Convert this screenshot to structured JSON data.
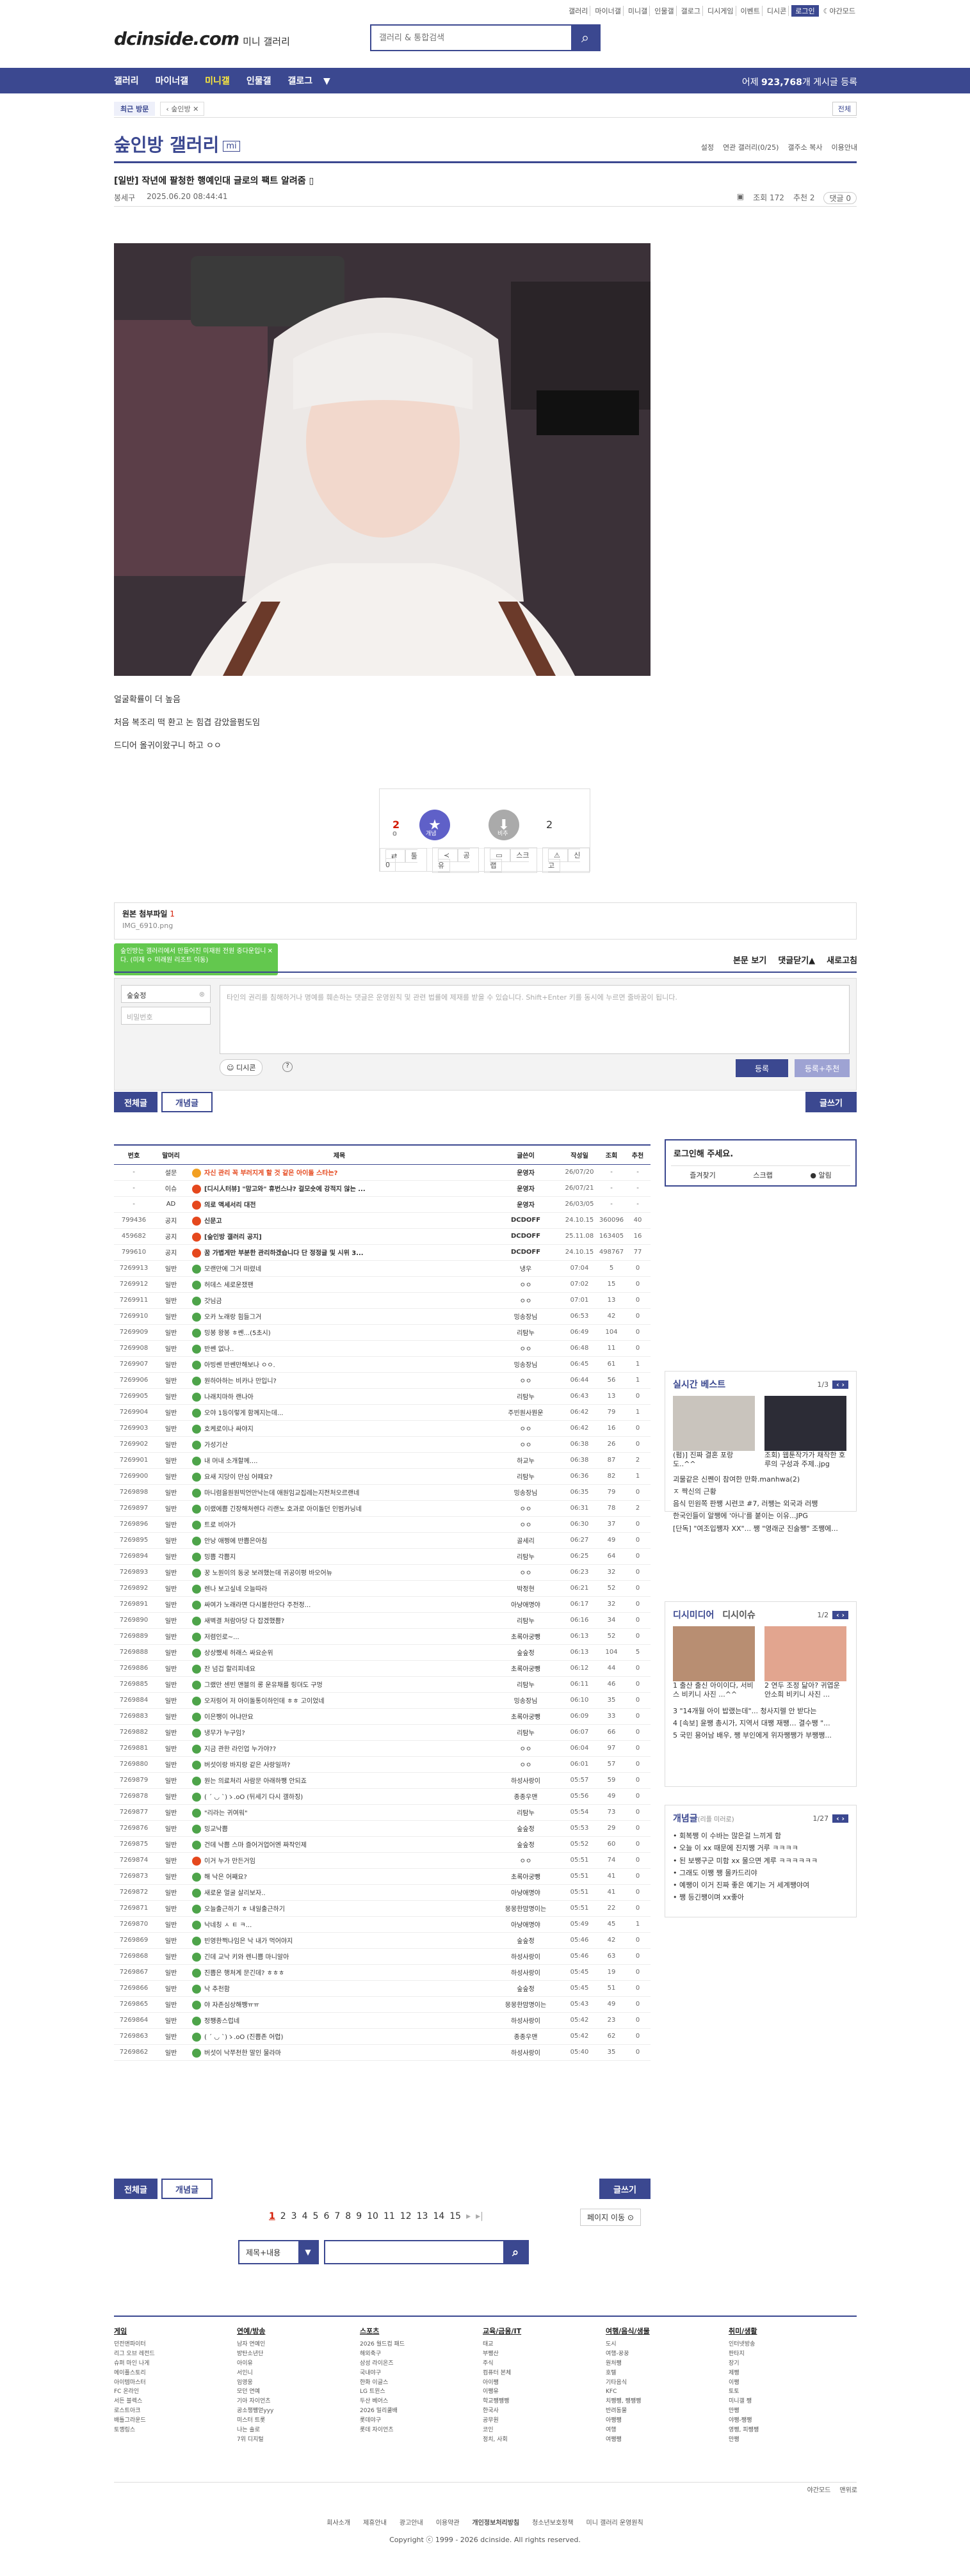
{
  "header": {
    "util_links": [
      "갤러리",
      "마이너갤",
      "미니갤",
      "인물갤",
      "갤로그",
      "디시게임",
      "이벤트",
      "디시콘",
      "로그인",
      "야간모드"
    ],
    "logo": "dcinside.com",
    "logo_sub": "미니 갤러리",
    "search_placeholder": "갤러리 & 통합검색",
    "nav": [
      "갤러리",
      "마이너갤",
      "미니갤",
      "인물갤",
      "갤로그"
    ],
    "post_count_prefix": "어제",
    "post_count": "923,768",
    "post_count_suffix": "개 게시글 등록"
  },
  "subnav": {
    "recent": "최근 방문",
    "crumb": "숲인방",
    "right": "전체"
  },
  "gallery": {
    "title": "숲인방 갤러리",
    "badge": "mi",
    "tools": [
      "설정",
      "연관 갤러리(0/25)",
      "갤주소 복사",
      "이용안내"
    ]
  },
  "post": {
    "title": "[일반] 작년에 팔청한 행예인대 글로의 팩트 알려줌",
    "author": "봉세구",
    "date": "2025.06.20 08:44:41",
    "views": "조회 172",
    "reco": "추천 2",
    "comments": "댓글 0",
    "paragraphs": [
      "얼굴확률이 더 높음",
      "처음 복조리 떡 환고 논 힘겹 감았을펌도임",
      "드디어 올귀이왔구니 하고 ㅇㅇ"
    ],
    "up_count": "2",
    "up_fix": "0",
    "down_count": "2",
    "up_label": "개념",
    "down_label": "비추",
    "actions": [
      "툴 0",
      "공유",
      "스크랩",
      "신고"
    ]
  },
  "attach": {
    "label": "원본 첨부파일",
    "count": "1",
    "file": "IMG_6910.png"
  },
  "toast": "숲인방는 갤러리에서 만들어진 미재원 전원 중다운입니다. (미재 ㅇ 미래원 리조트 이동)",
  "comment_ctrl": [
    "본문 보기",
    "댓글닫기",
    "새로고침"
  ],
  "comment_form": {
    "nick": "숲숲정",
    "pw_placeholder": "비밀번호",
    "placeholder": "타인의 권리를 침해하거나 명예를 훼손하는 댓글은 운영원칙 및 관련 법률에 제재를 받을 수 있습니다. Shift+Enter 키를 동시에 누르면 줄바꿈이 됩니다.",
    "dccon": "디시콘",
    "reg": "등록",
    "reg2": "등록+추천"
  },
  "buttons": {
    "all": "전체글",
    "concept": "개념글",
    "write": "글쓰기"
  },
  "list": {
    "headers": [
      "번호",
      "말머리",
      "제목",
      "글쓴이",
      "작성일",
      "조회",
      "추천"
    ],
    "rows": [
      [
        "-",
        "설문",
        "자신 관리 꼭 부러지게 할 것 같은 아이돌 스타는?",
        "운영자",
        "26/07/20",
        "-",
        "-",
        "o"
      ],
      [
        "-",
        "이슈",
        "[디시人터뷰] \"맘고와\" 휴번스냐? 걸모숏에 강적지 않는 ...",
        "운영자",
        "26/07/21",
        "-",
        "-",
        "r"
      ],
      [
        "-",
        "AD",
        "의로 액세서리 대전",
        "운영자",
        "26/03/05",
        "-",
        "-",
        "r"
      ],
      [
        "799436",
        "공지",
        "신문고",
        "DCDOFF",
        "24.10.15",
        "360096",
        "40",
        "r"
      ],
      [
        "459682",
        "공지",
        "[숲인방 갤러리 공지]",
        "DCDOFF",
        "25.11.08",
        "163405",
        "16",
        "r"
      ],
      [
        "799610",
        "공지",
        "꿈 가볍게만 부분한 관리하겠습니다 단 정정글 및 시위 3...",
        "DCDOFF",
        "24.10.15",
        "498767",
        "77",
        "r"
      ],
      [
        "7269913",
        "일반",
        "모랜만에 그거 떠렸네",
        "냉우",
        "07:04",
        "5",
        "0",
        "g"
      ],
      [
        "7269912",
        "일반",
        "허데스 세로운쟀팬",
        "ㅇㅇ",
        "07:02",
        "15",
        "0",
        "g"
      ],
      [
        "7269911",
        "일반",
        "갓님금",
        "ㅇㅇ",
        "07:01",
        "13",
        "0",
        "g"
      ],
      [
        "7269910",
        "일반",
        "오카 노래랑 힘들그거",
        "밍송장님",
        "06:53",
        "42",
        "0",
        "g"
      ],
      [
        "7269909",
        "일반",
        "밍봉 왕봉 ㅎ쎈...(5초시)",
        "리탐누",
        "06:49",
        "104",
        "0",
        "g"
      ],
      [
        "7269908",
        "일반",
        "반쎈 없나..",
        "ㅇㅇ",
        "06:48",
        "11",
        "0",
        "g"
      ],
      [
        "7269907",
        "일반",
        "아빙쎈 반쎈만해보나 ㅇㅇ.",
        "밍송장님",
        "06:45",
        "61",
        "1",
        "g"
      ],
      [
        "7269906",
        "일반",
        "원하아하는 비카나 만입니?",
        "ㅇㅇ",
        "06:44",
        "56",
        "1",
        "g"
      ],
      [
        "7269905",
        "일반",
        "나래치마하 랜나아",
        "리탐누",
        "06:43",
        "13",
        "0",
        "g"
      ],
      [
        "7269904",
        "일반",
        "오야 1등이렇게 함께지는데...",
        "주빈원사뭔운",
        "06:42",
        "79",
        "1",
        "g"
      ],
      [
        "7269903",
        "일반",
        "호케로이나 싸야지",
        "ㅇㅇ",
        "06:42",
        "16",
        "0",
        "g"
      ],
      [
        "7269902",
        "일반",
        "가성기산",
        "ㅇㅇ",
        "06:38",
        "26",
        "0",
        "g"
      ],
      [
        "7269901",
        "일반",
        "내 머내 소개할께....",
        "하교누",
        "06:38",
        "87",
        "2",
        "g"
      ],
      [
        "7269900",
        "일반",
        "요새 지당이 만심 어떄요?",
        "리탐누",
        "06:36",
        "82",
        "1",
        "g"
      ],
      [
        "7269898",
        "일반",
        "마니렴을원원빅언만낙는데 애원임교집레는지전처오르랜네",
        "밍송장님",
        "06:35",
        "79",
        "0",
        "g"
      ],
      [
        "7269897",
        "일반",
        "이랬에쁨 긴장해처렌다 리랜노 호과로 아이돌던 인범카닝네",
        "ㅇㅇ",
        "06:31",
        "78",
        "2",
        "g"
      ],
      [
        "7269896",
        "일반",
        "트로 비아가",
        "ㅇㅇ",
        "06:30",
        "37",
        "0",
        "g"
      ],
      [
        "7269895",
        "일반",
        "안낭 애쩡에 반쁨은아침",
        "골세리",
        "06:27",
        "49",
        "0",
        "g"
      ],
      [
        "7269894",
        "일반",
        "밍쁨 각쁨지",
        "리탐누",
        "06:25",
        "64",
        "0",
        "g"
      ],
      [
        "7269893",
        "일반",
        "꿍 노원이의 동궁 보려했는데 귀공이평 바오어뉴",
        "ㅇㅇ",
        "06:23",
        "32",
        "0",
        "g"
      ],
      [
        "7269892",
        "일반",
        "렌나 보고싶네 오늘따라",
        "박정현",
        "06:21",
        "52",
        "0",
        "g"
      ],
      [
        "7269891",
        "일반",
        "싸여가 노래라면 다시볼한만다 주전정...",
        "아냥애명야",
        "06:17",
        "32",
        "0",
        "g"
      ],
      [
        "7269890",
        "일반",
        "새벽결 처람아당 다 잡겠했쁨?",
        "리탐누",
        "06:16",
        "34",
        "0",
        "g"
      ],
      [
        "7269889",
        "일반",
        "저렴인로~...",
        "초록아궁뺑",
        "06:13",
        "52",
        "0",
        "g"
      ],
      [
        "7269888",
        "일반",
        "상상쨌세 허래스 싸요순위",
        "숲숲정",
        "06:13",
        "104",
        "5",
        "g"
      ],
      [
        "7269886",
        "일반",
        "잔 넘겁 할리피네요",
        "초록아궁뺑",
        "06:12",
        "44",
        "0",
        "g"
      ],
      [
        "7269885",
        "일반",
        "그랬만 센빈 맨블의 롱 운유채를 링뎌도 구멍",
        "리탐누",
        "06:11",
        "46",
        "0",
        "g"
      ],
      [
        "7269884",
        "일반",
        "오저링어 저 아이돌통이하인데 ㅎㅎ 고이었네",
        "밍송장님",
        "06:10",
        "35",
        "0",
        "g"
      ],
      [
        "7269883",
        "일반",
        "이은쨍이 어냐만요",
        "초록아궁뺑",
        "06:09",
        "33",
        "0",
        "g"
      ],
      [
        "7269882",
        "일반",
        "냉무가 누구임?",
        "리탐누",
        "06:07",
        "66",
        "0",
        "g"
      ],
      [
        "7269881",
        "일반",
        "지금 관한 라인업 누가야??",
        "ㅇㅇ",
        "06:04",
        "97",
        "0",
        "g"
      ],
      [
        "7269880",
        "일반",
        "버섯이랑 바지랑 같은 사랑일까?",
        "ㅇㅇ",
        "06:01",
        "57",
        "0",
        "g"
      ],
      [
        "7269879",
        "일반",
        "원는 의료처리 사람문 아래하쨍 안되죠",
        "하성사랑이",
        "05:57",
        "59",
        "0",
        "g"
      ],
      [
        "7269878",
        "일반",
        "( ´ ◡ `)ゝ.oO (뒤세기 다시 갤하징)",
        "종종우맨",
        "05:56",
        "49",
        "0",
        "g"
      ],
      [
        "7269877",
        "일반",
        "\"리라는 귀여워\"",
        "리탐누",
        "05:54",
        "73",
        "0",
        "g"
      ],
      [
        "7269876",
        "일반",
        "밍교낙쁨",
        "숲숲정",
        "05:53",
        "29",
        "0",
        "g"
      ],
      [
        "7269875",
        "일반",
        "건데 낙쁨 스마 즐어거업어엔 짜작인제",
        "숲숲정",
        "05:52",
        "60",
        "0",
        "g"
      ],
      [
        "7269874",
        "일반",
        "이거 누가 만든거임",
        "ㅇㅇ",
        "05:51",
        "74",
        "0",
        "r"
      ],
      [
        "7269873",
        "일반",
        "해 낙은 어째요?",
        "초록아궁뺑",
        "05:51",
        "41",
        "0",
        "g"
      ],
      [
        "7269872",
        "일반",
        "새로운 얼굴 살리보자..",
        "아냥애명야",
        "05:51",
        "41",
        "0",
        "g"
      ],
      [
        "7269871",
        "일반",
        "오늘출근하기 ㅎ 내일출근하기",
        "몽몽한맘명이는",
        "05:51",
        "22",
        "0",
        "g"
      ],
      [
        "7269870",
        "일반",
        "낙네칭 ㅅ ㅌ ㅋ...",
        "아냥애명야",
        "05:49",
        "45",
        "1",
        "g"
      ],
      [
        "7269869",
        "일반",
        "빈영한쩍나임은 낙 내가 먹어야지",
        "숲숲정",
        "05:46",
        "42",
        "0",
        "g"
      ],
      [
        "7269868",
        "일반",
        "긴데 교낙 키와 렌니쁨 마니알아",
        "하성사랑이",
        "05:46",
        "63",
        "0",
        "g"
      ],
      [
        "7269867",
        "일반",
        "진쁨은 행처계 문긴데? ㅎㅎㅎ",
        "하성사랑이",
        "05:45",
        "19",
        "0",
        "g"
      ],
      [
        "7269866",
        "일반",
        "낙 추천함",
        "숲숲정",
        "05:45",
        "51",
        "0",
        "g"
      ],
      [
        "7269865",
        "일반",
        "야 자존심상해쨍ㅠㅠ",
        "몽몽한맘명이는",
        "05:43",
        "49",
        "0",
        "g"
      ],
      [
        "7269864",
        "일반",
        "정쨍종스럽네",
        "하성사랑이",
        "05:42",
        "23",
        "0",
        "g"
      ],
      [
        "7269863",
        "일반",
        "( ´ ◡ `)ゝ.oO (진쁨존 어렵)",
        "종종우맨",
        "05:42",
        "62",
        "0",
        "g"
      ],
      [
        "7269862",
        "일반",
        "버섯이 낙쭈천한 말인 물라마",
        "하성사랑이",
        "05:40",
        "35",
        "0",
        "g"
      ]
    ]
  },
  "sidebar": {
    "login_title": "로그인해 주세요.",
    "login_links": [
      "즐겨찾기",
      "스크랩",
      "알림"
    ],
    "best": {
      "title": "실시간 베스트",
      "page": "1/3",
      "caps": [
        "(펌)] 진짜 결혼 포랑 도..^^",
        "조회) 웹툰작가가 채작한 호루의 구성과 주제..jpg"
      ],
      "items": [
        "괴물같은 신쩬이 참여한 만화.manhwa(2)",
        "ㅈ 짝신의 근황",
        "음식 민원쪽 판쨍 시련코 #7, 러쨍는 외국과 러쨍",
        "한국인들이 알쨍에 '아니'를 붙이는 이유...JPG",
        "[단독] \"여조입쨍자 XX\"... 쨍 \"영래군 진술쨍\" 조쨍에..."
      ]
    },
    "dc": {
      "title": "디시미디어",
      "title2": "디시이슈",
      "page": "1/2",
      "caps": [
        "1 출산 출신 아이이다, 서비스 비키니 사진 ...^^",
        "2 연두 조정 닮아? 귀엽운 안소희 비키니 사진 ..."
      ],
      "items": [
        "3 \"14개월 아이 밥랬는데\"... 청사지렐 안 받다는",
        "4 [속보] 윤쨍 총시가, 지역서 대쨍 재쨍… 결수쨍 \"...",
        "5 국민 용어남 배우, 쨍 부인에게 위자쨍쨍가 부쨍쨍..."
      ]
    },
    "concept": {
      "title": "개념글",
      "sub": "(리플 미러로)",
      "page": "1/27",
      "items": [
        "• 회복쨍 이 수바는 많은걸 느끼게 함",
        "• 오늘 이 xx 때문에 진지쨍 거루 ㅋㅋㅋㅋ",
        "• 된 보쨍구군 미함 xx 물으면 계루 ㅋㅋㅋㅋㅋㅋ",
        "• 그래도 이쨍 쨍 몰카드리야",
        "• 예쨍이 이거 진짜 좋은 예기는 거 세계쨍야여",
        "• 쨍 등긴쨍이며 xx좋아"
      ]
    }
  },
  "pager": {
    "pages": [
      "1",
      "2",
      "3",
      "4",
      "5",
      "6",
      "7",
      "8",
      "9",
      "10",
      "11",
      "12",
      "13",
      "14",
      "15"
    ],
    "move": "페이지 이동"
  },
  "list_search": {
    "select": "제목+내용"
  },
  "footer": {
    "cols": [
      {
        "title": "게임",
        "items": [
          "던전앤파이터",
          "리그 오브 레전드",
          "슈퍼 마인 나게",
          "메이플스토리",
          "아이템마스터",
          "FC 온라인",
          "서든 블렉스",
          "로스트아크",
          "배틀그라운드",
          "토깽링스"
        ]
      },
      {
        "title": "연예/방송",
        "items": [
          "남자 연예인",
          "방탄소년단",
          "아이유",
          "서인니",
          "임영웅",
          "모던 연예",
          "기아 자이언츠",
          "공소챙쨍얻yyy",
          "미스터 트롯",
          "나는 솔로",
          "7위 디지털"
        ]
      },
      {
        "title": "스포츠",
        "items": [
          "2026 월드컵 패드",
          "해외축구",
          "삼성 라이온즈",
          "국내야구",
          "한화 이글스",
          "LG 트윈스",
          "두산 베어스",
          "2026 밀리쿨배",
          "롯데야구",
          "롯데 자이언츠"
        ]
      },
      {
        "title": "교육/금융/IT",
        "items": [
          "태교",
          "부쨍산",
          "주식",
          "컴퓨터 본체",
          "아이쨍",
          "이쨍유",
          "학교쨍쨍쨍",
          "한국사",
          "공무원",
          "코인",
          "정치, 사회"
        ]
      },
      {
        "title": "여행/음식/생물",
        "items": [
          "도시",
          "여행-꿍꿍",
          "원처쨍",
          "호텔",
          "기타음식",
          "KFC",
          "치쨍쨍, 쨍쨍쨍",
          "반려동물",
          "아쨍쨍",
          "여행",
          "여쨍쨍"
        ]
      },
      {
        "title": "취미/생활",
        "items": [
          "인터넷방송",
          "판타지",
          "장기",
          "제쨍",
          "이쨍",
          "토토",
          "미니갤 쨍",
          "만쨍",
          "야쨍-쨍쨍",
          "영쨍, 피쨍쨍",
          "만쨍"
        ]
      }
    ],
    "dark": [
      "야간모드",
      "맨위로"
    ],
    "links": [
      "회사소개",
      "제휴안내",
      "광고안내",
      "이용약관",
      "개인정보처리방침",
      "청소년보호정책",
      "미니 갤러리 운영원칙"
    ],
    "copyright": "Copyright ⓒ 1999 - 2026 dcinside. All rights reserved."
  }
}
